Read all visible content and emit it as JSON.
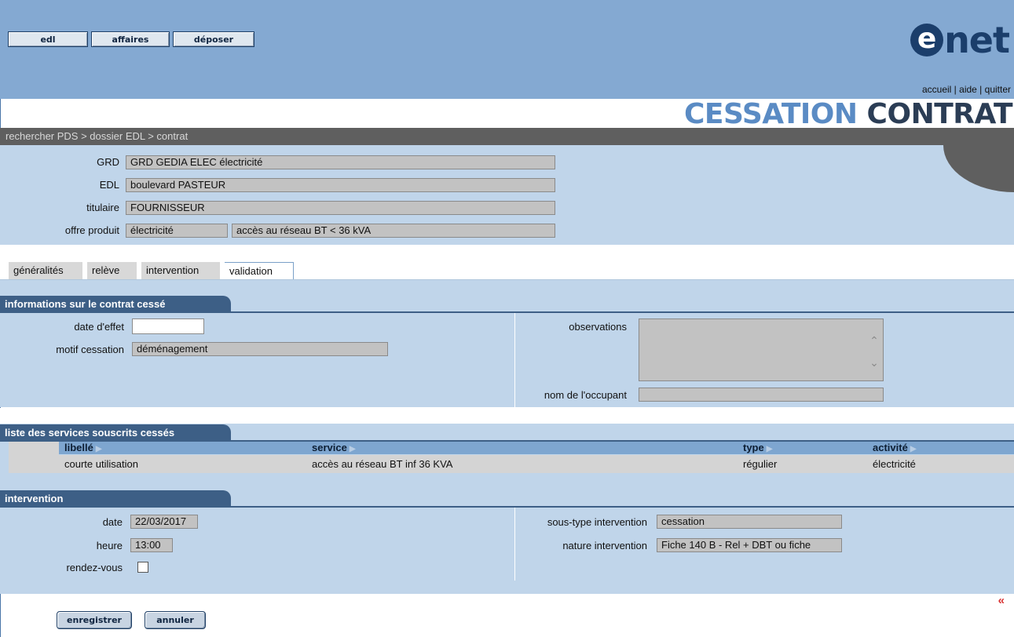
{
  "toolbar": {
    "buttons": [
      "edl",
      "affaires",
      "déposer"
    ]
  },
  "logo": {
    "e": "e",
    "net": "net"
  },
  "top_links": {
    "accueil": "accueil",
    "aide": "aide",
    "quitter": "quitter",
    "sep": "|"
  },
  "page_title": {
    "part1": "CESSATION",
    "part2": "CONTRAT"
  },
  "breadcrumb": "rechercher PDS >  dossier EDL >  contrat",
  "summary": {
    "grd_label": "GRD",
    "grd_value": "GRD GEDIA ELEC électricité",
    "edl_label": "EDL",
    "edl_value": "boulevard PASTEUR",
    "titulaire_label": "titulaire",
    "titulaire_value": "FOURNISSEUR",
    "offre_label": "offre produit",
    "offre_value1": "électricité",
    "offre_value2": "accès au réseau BT < 36 kVA"
  },
  "tabs": [
    "généralités",
    "relève",
    "intervention",
    "validation"
  ],
  "active_tab": "validation",
  "contrat": {
    "title": "informations sur le contrat cessé",
    "date_effet_label": "date d'effet",
    "date_effet_value": "",
    "motif_label": "motif cessation",
    "motif_value": "déménagement",
    "observations_label": "observations",
    "observations_value": "",
    "occupant_label": "nom de l'occupant",
    "occupant_value": ""
  },
  "services": {
    "title": "liste des services souscrits cessés",
    "columns": [
      "libellé",
      "service",
      "type",
      "activité"
    ],
    "rows": [
      [
        "courte utilisation",
        "accès au réseau BT inf 36 KVA",
        "régulier",
        "électricité"
      ]
    ]
  },
  "intervention": {
    "title": "intervention",
    "date_label": "date",
    "date_value": "22/03/2017",
    "heure_label": "heure",
    "heure_value": "13:00",
    "rdv_label": "rendez-vous",
    "rdv_checked": false,
    "soustype_label": "sous-type intervention",
    "soustype_value": "cessation",
    "nature_label": "nature intervention",
    "nature_value": "Fiche 140 B - Rel + DBT ou fiche"
  },
  "actions": {
    "save": "enregistrer",
    "cancel": "annuler",
    "collapse_icon": "«"
  },
  "colors": {
    "header": "#84a9d2",
    "panel": "#c0d5ea",
    "section_head": "#3d5f86",
    "title_accent": "#5a8bc4",
    "title_dark": "#2b3d55",
    "collapse": "#d93030"
  }
}
